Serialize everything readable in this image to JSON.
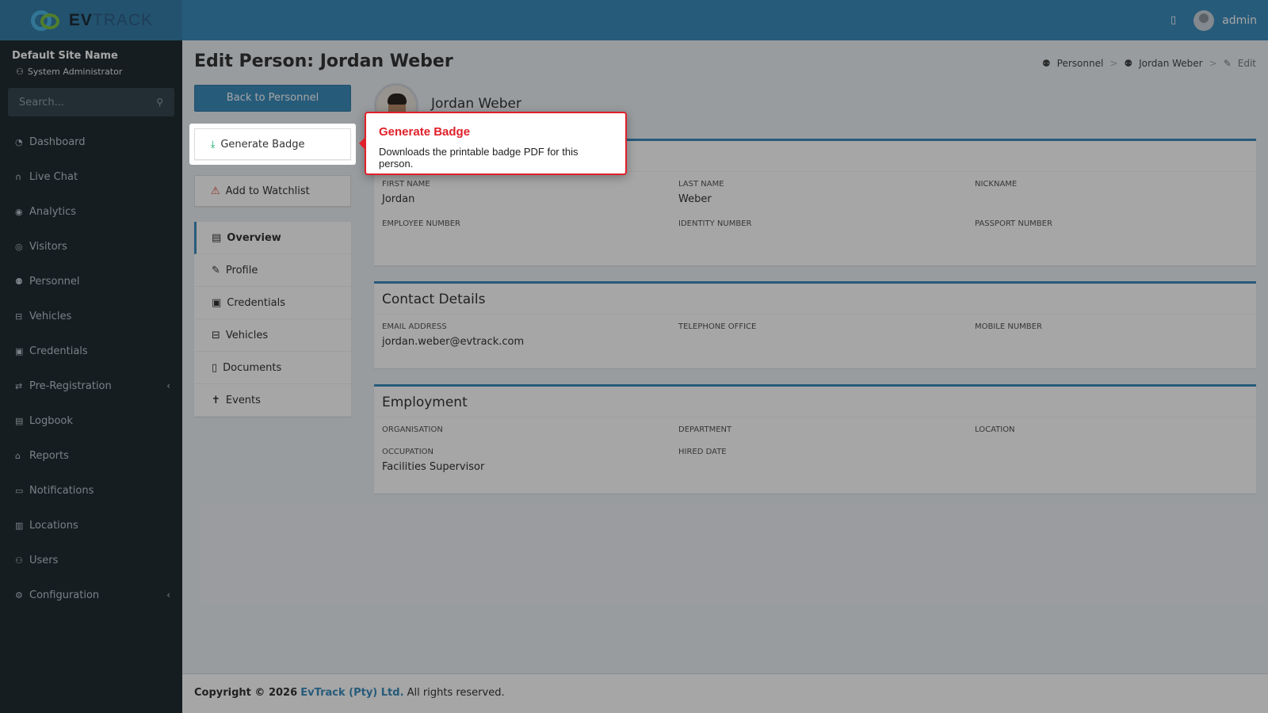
{
  "brand": {
    "ev": "EV",
    "track": "TRACK"
  },
  "topbar": {
    "user_name": "admin"
  },
  "sidebar": {
    "site_name": "Default Site Name",
    "site_role": "System Administrator",
    "search_placeholder": "Search...",
    "items": [
      {
        "label": "Dashboard",
        "icon": "dashboard-icon"
      },
      {
        "label": "Live Chat",
        "icon": "headset-icon"
      },
      {
        "label": "Analytics",
        "icon": "target-icon"
      },
      {
        "label": "Visitors",
        "icon": "eye-icon"
      },
      {
        "label": "Personnel",
        "icon": "users-icon"
      },
      {
        "label": "Vehicles",
        "icon": "car-icon"
      },
      {
        "label": "Credentials",
        "icon": "id-card-icon"
      },
      {
        "label": "Pre-Registration",
        "icon": "exchange-icon",
        "expandable": true
      },
      {
        "label": "Logbook",
        "icon": "book-icon"
      },
      {
        "label": "Reports",
        "icon": "chart-icon"
      },
      {
        "label": "Notifications",
        "icon": "comments-icon"
      },
      {
        "label": "Locations",
        "icon": "map-icon"
      },
      {
        "label": "Users",
        "icon": "user-cog-icon"
      },
      {
        "label": "Configuration",
        "icon": "gear-icon",
        "expandable": true
      }
    ]
  },
  "page": {
    "title": "Edit Person: Jordan Weber",
    "breadcrumb": [
      "Personnel",
      "Jordan Weber",
      "Edit"
    ]
  },
  "actions": {
    "back": "Back to Personnel",
    "generate_badge": "Generate Badge",
    "add_watchlist": "Add to Watchlist"
  },
  "menu": [
    "Overview",
    "Profile",
    "Credentials",
    "Vehicles",
    "Documents",
    "Events"
  ],
  "profile": {
    "name": "Jordan Weber"
  },
  "sections": {
    "personal": {
      "fields": [
        {
          "label": "FIRST NAME",
          "value": "Jordan"
        },
        {
          "label": "LAST NAME",
          "value": "Weber"
        },
        {
          "label": "NICKNAME",
          "value": ""
        },
        {
          "label": "EMPLOYEE NUMBER",
          "value": ""
        },
        {
          "label": "IDENTITY NUMBER",
          "value": ""
        },
        {
          "label": "PASSPORT NUMBER",
          "value": ""
        }
      ]
    },
    "contact": {
      "title": "Contact Details",
      "fields": [
        {
          "label": "EMAIL ADDRESS",
          "value": "jordan.weber@evtrack.com"
        },
        {
          "label": "TELEPHONE OFFICE",
          "value": ""
        },
        {
          "label": "MOBILE NUMBER",
          "value": ""
        }
      ]
    },
    "employment": {
      "title": "Employment",
      "fields": [
        {
          "label": "ORGANISATION",
          "value": ""
        },
        {
          "label": "DEPARTMENT",
          "value": ""
        },
        {
          "label": "LOCATION",
          "value": ""
        },
        {
          "label": "OCCUPATION",
          "value": "Facilities Supervisor"
        },
        {
          "label": "HIRED DATE",
          "value": ""
        }
      ]
    }
  },
  "tooltip": {
    "title": "Generate Badge",
    "text": "Downloads the printable badge PDF for this person."
  },
  "footer": {
    "prefix": "Copyright © 2026",
    "company": "EvTrack (Pty) Ltd.",
    "suffix": "All rights reserved."
  },
  "colors": {
    "primary": "#3c8dbc",
    "sidebar": "#222d32",
    "tooltip_accent": "#e0202a"
  }
}
